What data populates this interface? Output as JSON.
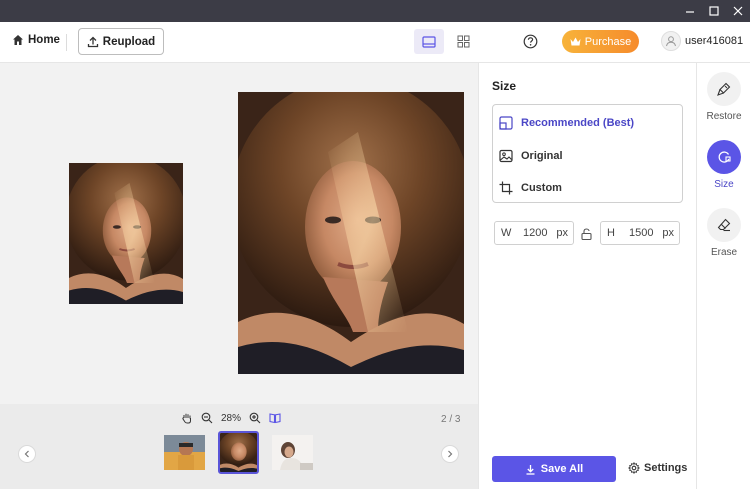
{
  "toolbar": {
    "home_label": "Home",
    "reupload_label": "Reupload",
    "purchase_label": "Purchase",
    "username": "user416081"
  },
  "canvas": {
    "zoom_level": "28%",
    "page_count": "2 / 3"
  },
  "panel": {
    "title": "Size",
    "options": [
      {
        "label": "Recommended (Best)",
        "icon": "recommended-size-icon",
        "active": true
      },
      {
        "label": "Original",
        "icon": "image-icon",
        "active": false
      },
      {
        "label": "Custom",
        "icon": "crop-icon",
        "active": false
      }
    ],
    "width": {
      "label": "W",
      "value": "1200",
      "unit": "px"
    },
    "height": {
      "label": "H",
      "value": "1500",
      "unit": "px"
    },
    "save_all_label": "Save All",
    "settings_label": "Settings"
  },
  "rail": {
    "tools": [
      {
        "label": "Restore",
        "icon": "brush-icon",
        "active": false
      },
      {
        "label": "Size",
        "icon": "size-icon",
        "active": true
      },
      {
        "label": "Erase",
        "icon": "eraser-icon",
        "active": false
      }
    ]
  },
  "colors": {
    "accent": "#5b55e6",
    "accent_text": "#4a46c6",
    "purchase_start": "#f7b33a",
    "purchase_end": "#f68b2c",
    "titlebar": "#3c3c46"
  }
}
